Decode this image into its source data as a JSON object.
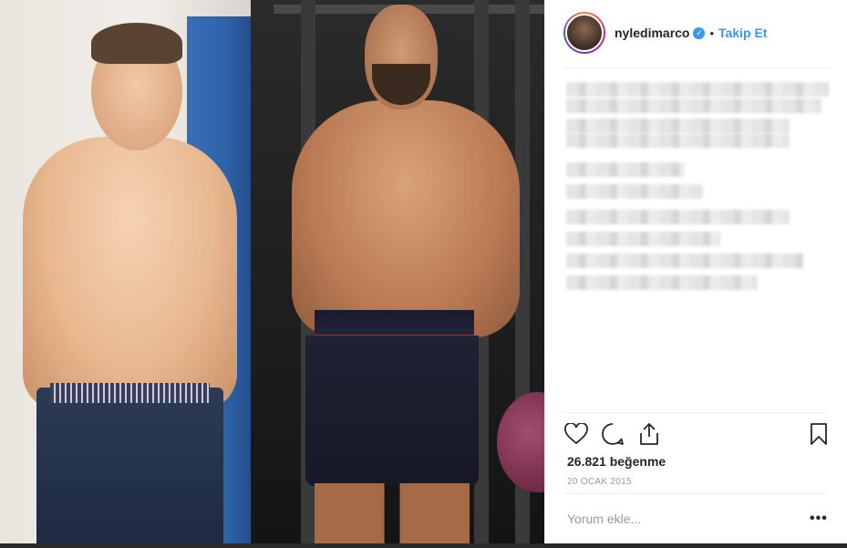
{
  "post": {
    "username": "nyledimarco",
    "verified_glyph": "✓",
    "separator": "•",
    "follow_label": "Takip Et",
    "likes": "26.821 beğenme",
    "date": "20 OCAK 2015",
    "comment_placeholder": "Yorum ekle...",
    "more_label": "•••"
  },
  "icons": {
    "like": "heart-icon",
    "comment": "comment-bubble-icon",
    "share": "share-icon",
    "save": "bookmark-icon"
  },
  "colors": {
    "accent": "#3897f0",
    "text": "#262626",
    "muted": "#999999"
  }
}
